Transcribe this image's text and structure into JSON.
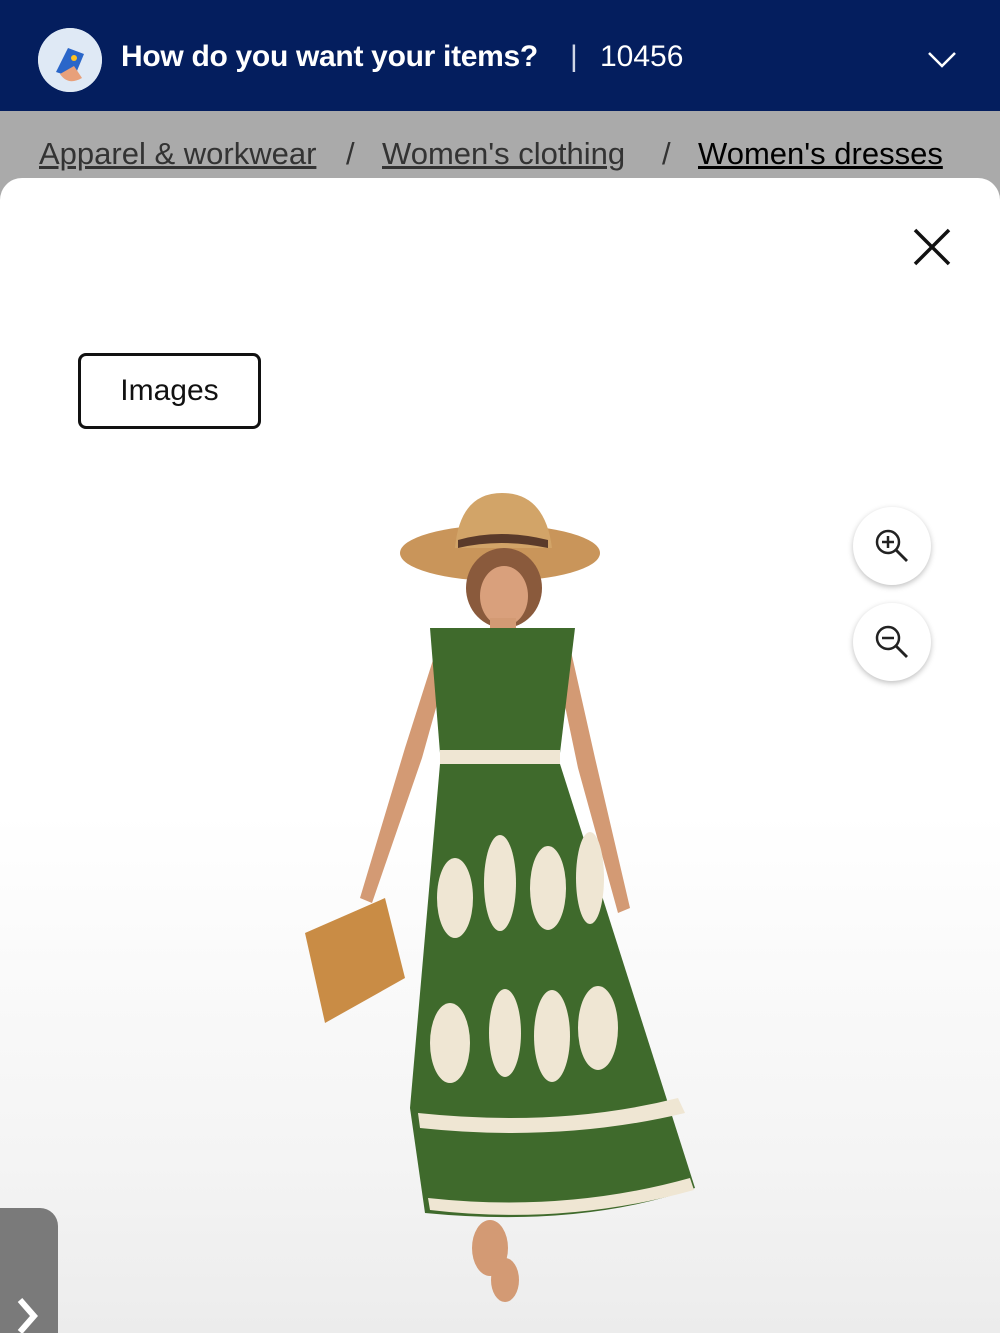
{
  "header": {
    "title": "How do you want your items?",
    "separator": "|",
    "zip": "10456",
    "avatar_icon": "spark-phone-icon",
    "dropdown_icon": "chevron-down-icon",
    "background": "#041e5e"
  },
  "breadcrumb": {
    "items": [
      {
        "label": "Apparel & workwear"
      },
      {
        "label": "Women's clothing"
      },
      {
        "label": "Women's dresses"
      }
    ],
    "separator": "/"
  },
  "viewer": {
    "close_icon": "close-icon",
    "images_tab_label": "Images",
    "zoom_in_icon": "zoom-in-icon",
    "zoom_out_icon": "zoom-out-icon",
    "next_icon": "chevron-right-icon",
    "product_image": "green-printed-maxi-dress-photo",
    "dress_color": "#3f6a2c"
  }
}
